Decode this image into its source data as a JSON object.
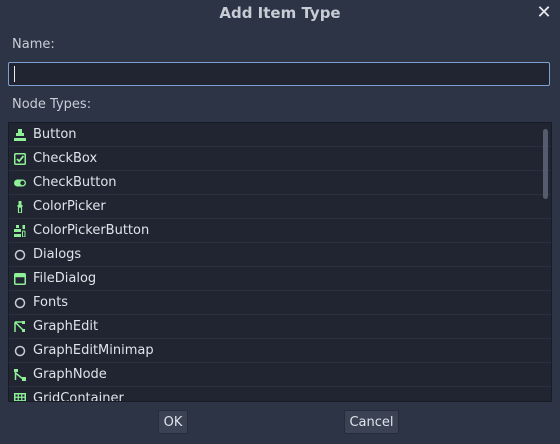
{
  "dialog": {
    "title": "Add Item Type",
    "close_label": "✕"
  },
  "name_field": {
    "label": "Name:",
    "value": "",
    "placeholder": ""
  },
  "node_types": {
    "label": "Node Types:",
    "items": [
      {
        "label": "Button",
        "icon": "button-node-icon"
      },
      {
        "label": "CheckBox",
        "icon": "checkbox-node-icon"
      },
      {
        "label": "CheckButton",
        "icon": "check-button-node-icon"
      },
      {
        "label": "ColorPicker",
        "icon": "color-picker-node-icon"
      },
      {
        "label": "ColorPickerButton",
        "icon": "color-picker-button-node-icon"
      },
      {
        "label": "Dialogs",
        "icon": "circle-icon"
      },
      {
        "label": "FileDialog",
        "icon": "file-dialog-node-icon"
      },
      {
        "label": "Fonts",
        "icon": "circle-icon"
      },
      {
        "label": "GraphEdit",
        "icon": "graph-edit-node-icon"
      },
      {
        "label": "GraphEditMinimap",
        "icon": "circle-icon"
      },
      {
        "label": "GraphNode",
        "icon": "graph-node-node-icon"
      },
      {
        "label": "GridContainer",
        "icon": "grid-container-node-icon"
      }
    ]
  },
  "buttons": {
    "ok": "OK",
    "cancel": "Cancel"
  },
  "colors": {
    "background": "#2d3446",
    "panel": "#202531",
    "node_icon_green": "#8eef97",
    "text": "#dfe3ea",
    "input_border_focus": "#7f9fd0"
  }
}
